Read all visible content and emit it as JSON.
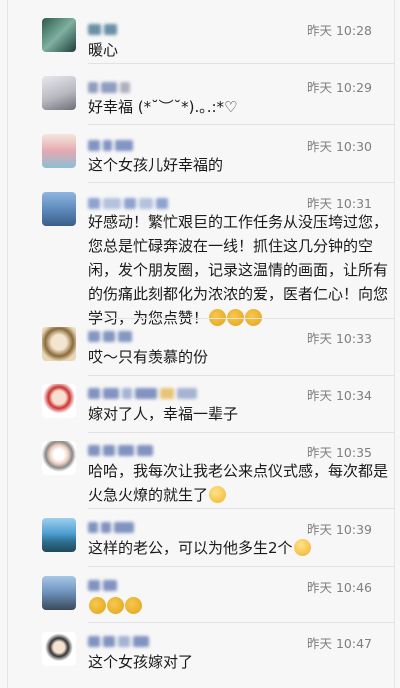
{
  "comments": [
    {
      "name_blur": [
        "#3a6e8a",
        "#3a6e8a"
      ],
      "time": "昨天 10:28",
      "text": "暖心",
      "emoji": []
    },
    {
      "name_blur": [
        "#6c7fae",
        "#6c7fae",
        "#9aa"
      ],
      "time": "昨天 10:29",
      "text": "好幸福 (*˘︶˘*).｡.:*♡",
      "emoji": []
    },
    {
      "name_blur": [
        "#5a74b2",
        "#5a74b2",
        "#5a74b2"
      ],
      "time": "昨天 10:30",
      "text": "这个女孩儿好幸福的",
      "emoji": []
    },
    {
      "name_blur": [
        "#6b86c2",
        "#6b86c2",
        "#9fb0d6",
        "#6b86c2",
        "#9fb0d6"
      ],
      "time": "昨天 10:31",
      "text": "好感动！繁忙艰巨的工作任务从没压垮过您，您总是忙碌奔波在一线！抓住这几分钟的空闲，发个朋友圈，记录这温情的画面，让所有的伤痛此刻都化为浓浓的爱，医者仁心！向您学习，为您点赞！",
      "emoji": [
        "thumbs-up",
        "thumbs-up",
        "thumbs-up"
      ]
    },
    {
      "name_blur": [
        "#5d77b0",
        "#5d77b0",
        "#5d77b0"
      ],
      "time": "昨天 10:33",
      "text": "哎～只有羡慕的份",
      "emoji": []
    },
    {
      "name_blur": [
        "#5a72ae",
        "#5a72ae",
        "#8a9cc8",
        "#5a72ae",
        "#e4b34a",
        "#8a9cc8"
      ],
      "time": "昨天 10:34",
      "text": "嫁对了人，幸福一辈子",
      "emoji": []
    },
    {
      "name_blur": [
        "#5a72ae",
        "#5a72ae",
        "#5a72ae",
        "#5a72ae"
      ],
      "time": "昨天 10:35",
      "text": "哈哈，我每次让我老公来点仪式感，每次都是火急火燎的就生了",
      "emoji": [
        "laughing-face"
      ]
    },
    {
      "name_blur": [
        "#5a72ae",
        "#5a72ae",
        "#5a72ae"
      ],
      "time": "昨天 10:39",
      "text": "这样的老公，可以为他多生2个",
      "emoji": [
        "grinning-face"
      ]
    },
    {
      "name_blur": [
        "#5a72ae",
        "#5a72ae"
      ],
      "time": "昨天 10:46",
      "text": "",
      "emoji": [
        "thumbs-up",
        "thumbs-up",
        "thumbs-up"
      ]
    },
    {
      "name_blur": [
        "#5a72ae",
        "#5a72ae",
        "#8a9cc8",
        "#5a72ae"
      ],
      "time": "昨天 10:47",
      "text": "这个女孩嫁对了",
      "emoji": []
    }
  ],
  "colors": {
    "name": "#5a72ae",
    "time": "#7f7f7f",
    "text": "#1a1a1a",
    "separator": "#e2e2e2"
  }
}
